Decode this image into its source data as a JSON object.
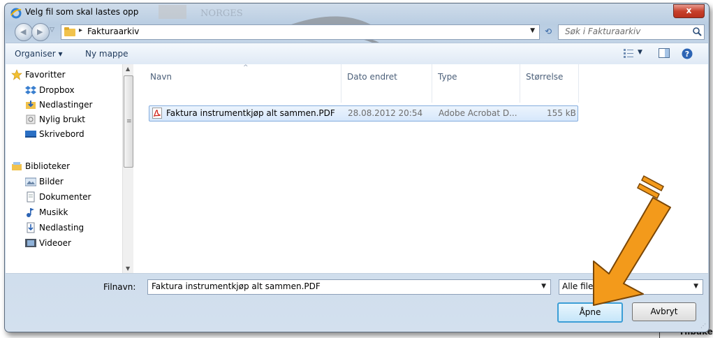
{
  "dialog": {
    "title": "Velg fil som skal lastes opp",
    "close_label": "x"
  },
  "address": {
    "path": "Fakturaarkiv"
  },
  "search": {
    "placeholder": "Søk i Fakturaarkiv"
  },
  "toolbar": {
    "organize_label": "Organiser ▾",
    "new_folder_label": "Ny mappe"
  },
  "sidebar": {
    "favorites_label": "Favoritter",
    "favorites": [
      {
        "label": "Dropbox",
        "icon": "dropbox-icon"
      },
      {
        "label": "Nedlastinger",
        "icon": "downloads-folder-icon"
      },
      {
        "label": "Nylig brukt",
        "icon": "recent-places-icon"
      },
      {
        "label": "Skrivebord",
        "icon": "desktop-icon"
      }
    ],
    "libraries_label": "Biblioteker",
    "libraries": [
      {
        "label": "Bilder",
        "icon": "pictures-icon"
      },
      {
        "label": "Dokumenter",
        "icon": "documents-icon"
      },
      {
        "label": "Musikk",
        "icon": "music-icon"
      },
      {
        "label": "Nedlasting",
        "icon": "downloads-icon"
      },
      {
        "label": "Videoer",
        "icon": "videos-icon"
      }
    ]
  },
  "filelist": {
    "columns": [
      "Navn",
      "Dato endret",
      "Type",
      "Størrelse"
    ],
    "files": [
      {
        "name": "Faktura instrumentkjøp alt sammen.PDF",
        "modified": "28.08.2012 20:54",
        "type": "Adobe Acrobat D...",
        "size": "155 kB",
        "icon": "pdf-icon"
      }
    ]
  },
  "bottom": {
    "filename_label": "Filnavn:",
    "filename_value": "Faktura instrumentkjøp alt sammen.PDF",
    "filter_value": "Alle filer (*",
    "open_label": "Åpne",
    "cancel_label": "Avbryt"
  },
  "background": {
    "partial_text": "Tilbake"
  },
  "colors": {
    "arrow": "#f39a1b",
    "selection": "#d6e7fb",
    "close_button": "#c7412c"
  }
}
